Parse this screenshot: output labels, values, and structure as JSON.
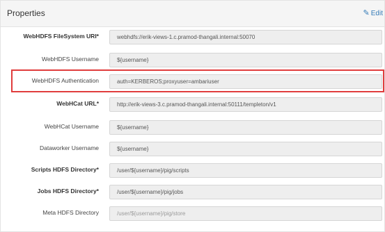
{
  "panel": {
    "title": "Properties",
    "edit_label": "Edit"
  },
  "fields": [
    {
      "label": "WebHDFS FileSystem URI*",
      "value": "webhdfs://erik-views-1.c.pramod-thangali.internal:50070",
      "required": true,
      "is_placeholder": false
    },
    {
      "label": "WebHDFS Username",
      "value": "${username}",
      "required": false,
      "is_placeholder": false
    },
    {
      "label": "WebHDFS Authentication",
      "value": "auth=KERBEROS;proxyuser=ambariuser",
      "required": false,
      "is_placeholder": false,
      "highlighted": true
    },
    {
      "label": "WebHCat URL*",
      "value": "http://erik-views-3.c.pramod-thangali.internal:50111/templeton/v1",
      "required": true,
      "is_placeholder": false
    },
    {
      "label": "WebHCat Username",
      "value": "${username}",
      "required": false,
      "is_placeholder": false
    },
    {
      "label": "Dataworker Username",
      "value": "${username}",
      "required": false,
      "is_placeholder": false
    },
    {
      "label": "Scripts HDFS Directory*",
      "value": "/user/${username}/pig/scripts",
      "required": true,
      "is_placeholder": false
    },
    {
      "label": "Jobs HDFS Directory*",
      "value": "/user/${username}/pig/jobs",
      "required": true,
      "is_placeholder": false
    },
    {
      "label": "Meta HDFS Directory",
      "value": "/user/${username}/pig/store",
      "required": false,
      "is_placeholder": true
    }
  ],
  "colors": {
    "highlight": "#e03c3c",
    "link": "#337ab7",
    "input_bg": "#eeeeee"
  },
  "icons": {
    "edit": "pencil-icon"
  }
}
